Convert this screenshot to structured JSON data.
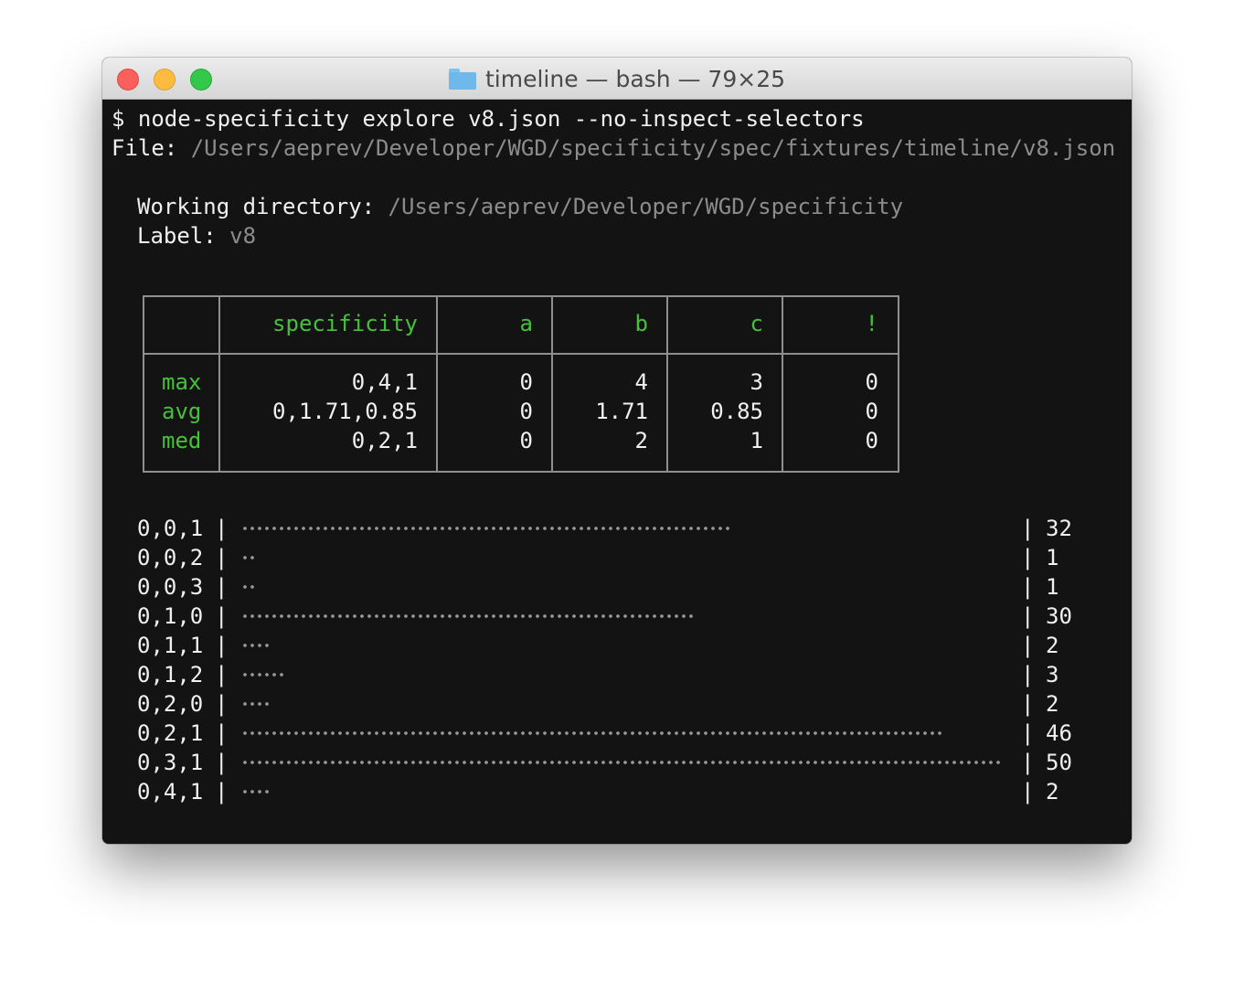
{
  "window": {
    "title": "timeline — bash — 79×25"
  },
  "terminal": {
    "prompt": "$ ",
    "command": "node-specificity explore v8.json --no-inspect-selectors",
    "file_label": "File:",
    "file_path": "/Users/aeprev/Developer/WGD/specificity/spec/fixtures/timeline/v8.json",
    "workdir_label": "Working directory:",
    "workdir_path": "/Users/aeprev/Developer/WGD/specificity",
    "label_label": "Label:",
    "label_value": "v8"
  },
  "stats_table": {
    "headers": [
      "",
      "specificity",
      "a",
      "b",
      "c",
      "!"
    ],
    "rows": [
      {
        "name": "max",
        "specificity": "0,4,1",
        "a": "0",
        "b": "4",
        "c": "3",
        "important": "0"
      },
      {
        "name": "avg",
        "specificity": "0,1.71,0.85",
        "a": "0",
        "b": "1.71",
        "c": "0.85",
        "important": "0"
      },
      {
        "name": "med",
        "specificity": "0,2,1",
        "a": "0",
        "b": "2",
        "c": "1",
        "important": "0"
      }
    ]
  },
  "histogram": {
    "separator": "|",
    "max_count": 50,
    "rows": [
      {
        "specificity": "0,0,1",
        "count": 32
      },
      {
        "specificity": "0,0,2",
        "count": 1
      },
      {
        "specificity": "0,0,3",
        "count": 1
      },
      {
        "specificity": "0,1,0",
        "count": 30
      },
      {
        "specificity": "0,1,1",
        "count": 2
      },
      {
        "specificity": "0,1,2",
        "count": 3
      },
      {
        "specificity": "0,2,0",
        "count": 2
      },
      {
        "specificity": "0,2,1",
        "count": 46
      },
      {
        "specificity": "0,3,1",
        "count": 50
      },
      {
        "specificity": "0,4,1",
        "count": 2
      }
    ]
  },
  "colors": {
    "accent_green": "#46c13a",
    "dim_text": "#8c8c8c",
    "background": "#131313"
  }
}
